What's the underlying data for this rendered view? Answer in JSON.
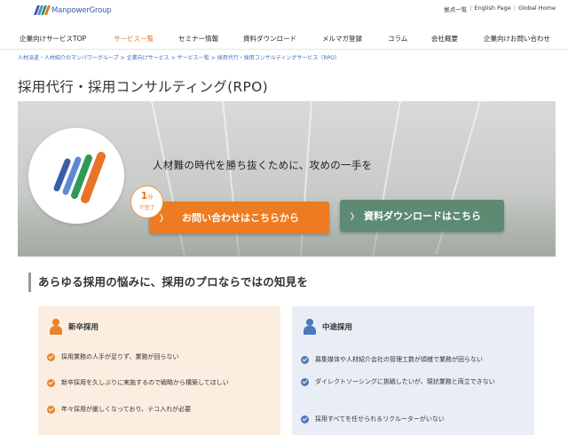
{
  "header": {
    "logo_text": "ManpowerGroup",
    "util_links": [
      "拠点一覧",
      "English Page",
      "Global Home"
    ]
  },
  "gnav": [
    {
      "label": "企業向けサービスTOP",
      "active": false
    },
    {
      "label": "サービス一覧",
      "active": true
    },
    {
      "label": "セミナー情報",
      "active": false
    },
    {
      "label": "資料ダウンロード",
      "active": false
    },
    {
      "label": "メルマガ登録",
      "active": false
    },
    {
      "label": "コラム",
      "active": false
    },
    {
      "label": "会社概要",
      "active": false
    },
    {
      "label": "企業向けお問い合わせ",
      "active": false
    }
  ],
  "breadcrumb": [
    "人材派遣・人材紹介のマンパワーグループ",
    "企業向けサービス",
    "サービス一覧",
    "採用代行・採用コンサルティングサービス（RPO）"
  ],
  "page_title": "採用代行・採用コンサルティング(RPO)",
  "hero": {
    "tagline": "人材難の時代を勝ち抜くために、攻めの一手を",
    "badge_num": "1",
    "badge_unit": "分",
    "badge_sub": "で完了",
    "contact_button": "お問い合わせはこちらから",
    "download_button": "資料ダウンロードはこちら",
    "arrow": "〉"
  },
  "section_title": "あらゆる採用の悩みに、採用のプロならではの知見を",
  "cards": {
    "new_grad": {
      "title": "新卒採用",
      "items": [
        "採用業務の人手が足りず、業務が回らない",
        "新卒採用を久しぶりに実施するので戦略から構築してほしい",
        "年々採用が厳しくなっており、テコ入れが必要"
      ]
    },
    "mid_career": {
      "title": "中途採用",
      "items": [
        "募集媒体や人材紹介会社の管理工数が煩雑で業務が回らない",
        "ダイレクトソーシングに挑戦したいが、現状業務と両立できない",
        "採用すべてを任せられるリクルーターがいない"
      ]
    }
  },
  "colors": {
    "accent_orange": "#ec7b22",
    "accent_green": "#5d8a73",
    "link_blue": "#3a6ec2",
    "card_orange_bg": "#fbeee0",
    "card_blue_bg": "#e9eef6"
  }
}
